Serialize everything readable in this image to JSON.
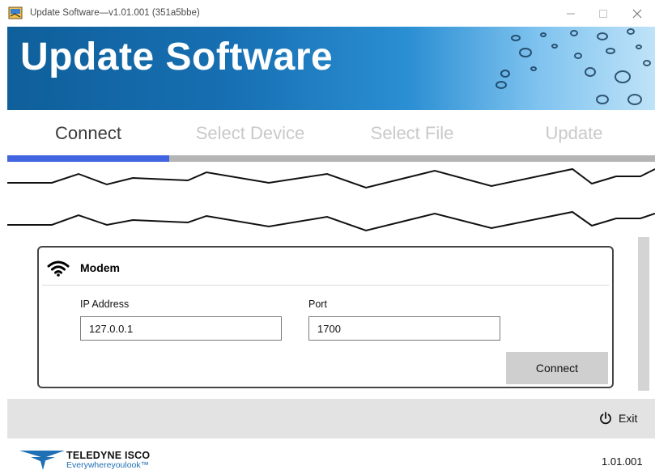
{
  "window": {
    "title": "Update Software—v1.01.001 (351a5bbe)",
    "controls": [
      "minimize",
      "maximize",
      "close"
    ]
  },
  "banner": {
    "title": "Update Software",
    "background_colors": [
      "#0f5f9a",
      "#2b8fd3",
      "#bfe3f8"
    ]
  },
  "steps": {
    "items": [
      {
        "label": "Connect",
        "active": true
      },
      {
        "label": "Select Device",
        "active": false
      },
      {
        "label": "Select File",
        "active": false
      },
      {
        "label": "Update",
        "active": false
      }
    ],
    "progress_fraction": 0.25,
    "accent_color": "#4165e0"
  },
  "modem": {
    "icon": "wifi-icon",
    "title": "Modem",
    "ip_label": "IP Address",
    "ip_value": "127.0.0.1",
    "port_label": "Port",
    "port_value": "1700",
    "connect_label": "Connect"
  },
  "footer": {
    "exit_label": "Exit",
    "exit_icon": "power-icon",
    "logo_brand": "TELEDYNE ISCO",
    "logo_tagline": "Everywhereyoulook™",
    "version": "1.01.001"
  }
}
